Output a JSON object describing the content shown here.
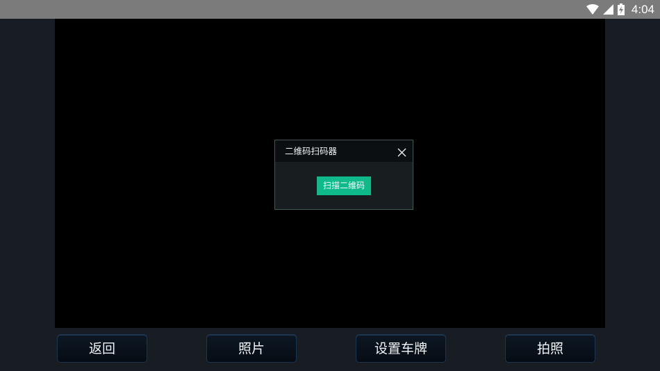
{
  "status_bar": {
    "time": "4:04",
    "icons": [
      "wifi-icon",
      "signal-icon",
      "battery-charging-icon"
    ]
  },
  "dialog": {
    "title": "二维码扫码器",
    "close_icon": "close-icon",
    "scan_button_label": "扫描二维码"
  },
  "toolbar": {
    "back_label": "返回",
    "photos_label": "照片",
    "set_plate_label": "设置车牌",
    "take_photo_label": "拍照"
  },
  "colors": {
    "background": "#171d22",
    "status_bar": "#7b7b7b",
    "camera_view": "#000000",
    "accent": "#10b98a"
  }
}
